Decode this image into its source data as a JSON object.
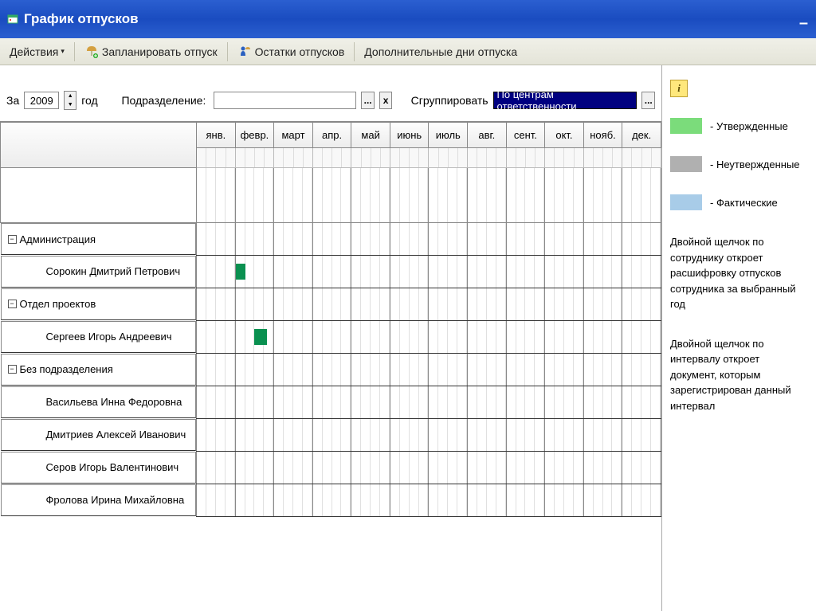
{
  "window": {
    "title": "График отпусков"
  },
  "toolbar": {
    "actions": "Действия",
    "plan": "Запланировать отпуск",
    "remains": "Остатки отпусков",
    "extra": "Дополнительные дни отпуска"
  },
  "filter": {
    "za": "За",
    "year": "2009",
    "god": "год",
    "dept_label": "Подразделение:",
    "dots": "...",
    "x": "x",
    "group_label": "Сгруппировать",
    "group_value": "По центрам ответственности"
  },
  "months": [
    "янв.",
    "февр.",
    "март",
    "апр.",
    "май",
    "июнь",
    "июль",
    "авг.",
    "сент.",
    "окт.",
    "нояб.",
    "дек."
  ],
  "rows": [
    {
      "type": "group",
      "label": "Администрация"
    },
    {
      "type": "emp",
      "label": "Сорокин Дмитрий Петрович",
      "bar": {
        "month": 1,
        "week": 0,
        "span": 1
      }
    },
    {
      "type": "group",
      "label": "Отдел проектов"
    },
    {
      "type": "emp",
      "label": "Сергеев Игорь Андреевич",
      "bar": {
        "month": 1,
        "week": 2,
        "span": 1.3
      }
    },
    {
      "type": "group",
      "label": "Без подразделения"
    },
    {
      "type": "emp",
      "label": "Васильева Инна Федоровна"
    },
    {
      "type": "emp",
      "label": "Дмитриев Алексей Иванович"
    },
    {
      "type": "emp",
      "label": "Серов Игорь Валентинович"
    },
    {
      "type": "emp",
      "label": "Фролова Ирина Михайловна"
    }
  ],
  "legend": {
    "approved": "- Утвержденные",
    "unapproved": "- Неутвержденные",
    "actual": "- Фактические"
  },
  "help": {
    "p1": "Двойной щелчок по сотруднику откроет расшифровку отпусков сотрудника за выбранный год",
    "p2": "Двойной щелчок по интервалу откроет документ, которым зарегистрирован данный интервал"
  }
}
